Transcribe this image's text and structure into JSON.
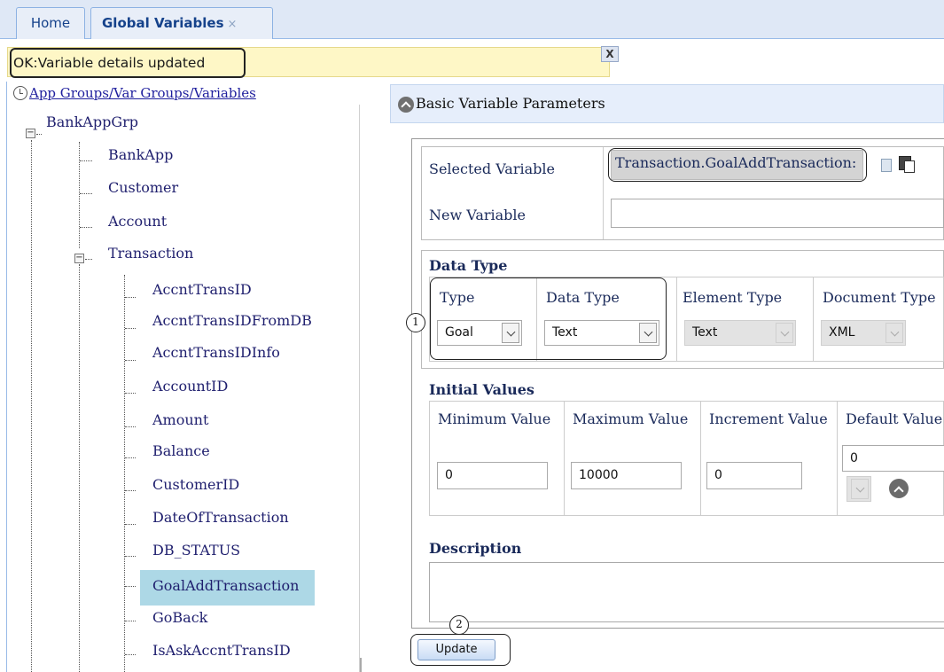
{
  "tabs": {
    "home": "Home",
    "global_variables": "Global Variables",
    "close_glyph": "×"
  },
  "status": {
    "message": "OK:Variable details updated",
    "close_label": "X"
  },
  "tree": {
    "root_label": "App Groups/Var Groups/Variables",
    "group": "BankAppGrp",
    "groups_children": [
      "BankApp",
      "Customer",
      "Account",
      "Transaction"
    ],
    "transaction_children": [
      "AccntTransID",
      "AccntTransIDFromDB",
      "AccntTransIDInfo",
      "AccountID",
      "Amount",
      "Balance",
      "CustomerID",
      "DateOfTransaction",
      "DB_STATUS",
      "GoalAddTransaction",
      "GoBack",
      "IsAskAccntTransID"
    ],
    "selected": "GoalAddTransaction"
  },
  "panel": {
    "title": "Basic Variable Parameters",
    "selected_variable_label": "Selected Variable",
    "selected_variable_value": "Transaction.GoalAddTransaction:",
    "new_variable_label": "New Variable",
    "new_variable_value": "",
    "data_type_section": "Data Type",
    "type_label": "Type",
    "type_value": "Goal",
    "data_type_label": "Data Type",
    "data_type_value": "Text",
    "element_type_label": "Element Type",
    "element_type_value": "Text",
    "document_type_label": "Document Type",
    "document_type_value": "XML",
    "initial_values_section": "Initial Values",
    "min_label": "Minimum Value",
    "min_value": "0",
    "max_label": "Maximum Value",
    "max_value": "10000",
    "inc_label": "Increment Value",
    "inc_value": "0",
    "default_label": "Default Value",
    "default_value": "0",
    "description_section": "Description",
    "description_value": "",
    "update_button": "Update"
  },
  "callouts": [
    "1",
    "2"
  ]
}
